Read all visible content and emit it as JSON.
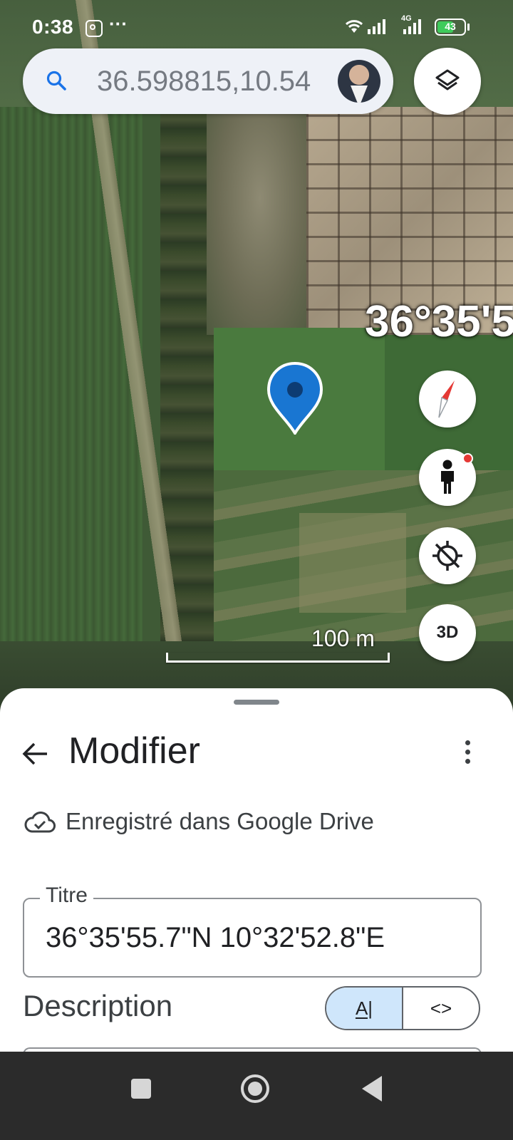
{
  "status_bar": {
    "time": "0:38",
    "more": "···",
    "network": "4G",
    "battery": "43"
  },
  "search": {
    "query": "36.598815,10.54"
  },
  "map": {
    "coordinate_overlay": "36°35'5",
    "scale_label": "100 m",
    "button_3d": "3D"
  },
  "sheet": {
    "title": "Modifier",
    "saved_status": "Enregistré dans Google Drive",
    "title_field_label": "Titre",
    "title_field_value": "36°35'55.7\"N 10°32'52.8\"E",
    "description_label": "Description",
    "toggle_text_label": "A|",
    "toggle_code_label": "<>"
  },
  "colors": {
    "accent": "#1a73e8",
    "pin": "#1976d2",
    "toggle_active": "#cfe6fb",
    "battery": "#3ecb5b"
  }
}
